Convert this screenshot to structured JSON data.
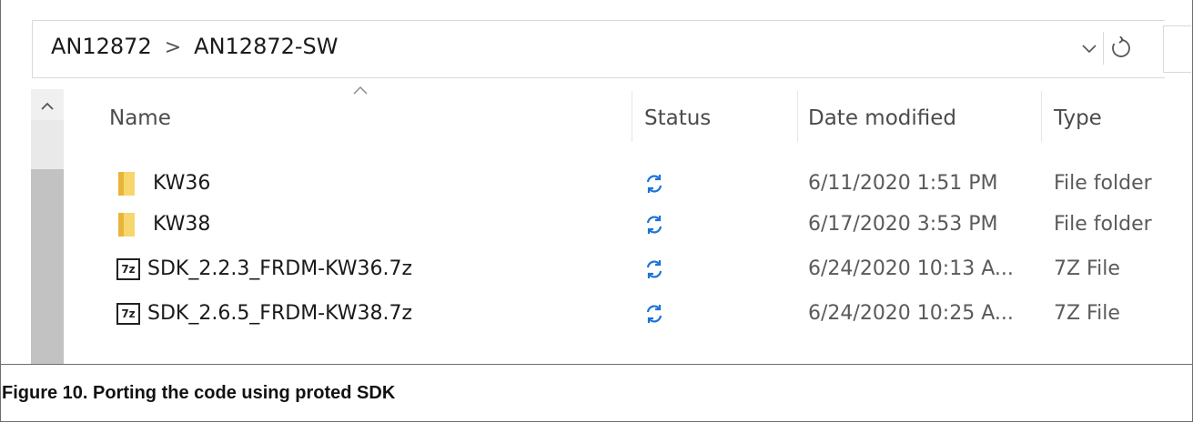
{
  "breadcrumb": {
    "items": [
      "AN12872",
      "AN12872-SW"
    ],
    "separator": ">"
  },
  "address_bar": {
    "dropdown_icon": "chevron-down-icon",
    "refresh_icon": "refresh-icon"
  },
  "columns": {
    "name": "Name",
    "status": "Status",
    "date": "Date modified",
    "type": "Type"
  },
  "files": [
    {
      "name": "KW36",
      "icon": "folder-icon",
      "status_icon": "sync-icon",
      "date": "6/11/2020 1:51 PM",
      "type": "File folder"
    },
    {
      "name": "KW38",
      "icon": "folder-icon",
      "status_icon": "sync-icon",
      "date": "6/17/2020 3:53 PM",
      "type": "File folder"
    },
    {
      "name": "SDK_2.2.3_FRDM-KW36.7z",
      "icon": "7z-file-icon",
      "icon_text": "7z",
      "status_icon": "sync-icon",
      "date": "6/24/2020 10:13 A...",
      "type": "7Z File"
    },
    {
      "name": "SDK_2.6.5_FRDM-KW38.7z",
      "icon": "7z-file-icon",
      "icon_text": "7z",
      "status_icon": "sync-icon",
      "date": "6/24/2020 10:25 A...",
      "type": "7Z File"
    }
  ],
  "caption": "Figure 10. Porting the code using proted SDK",
  "colors": {
    "sync_blue": "#1e74d6",
    "folder": "#e8b53a"
  }
}
